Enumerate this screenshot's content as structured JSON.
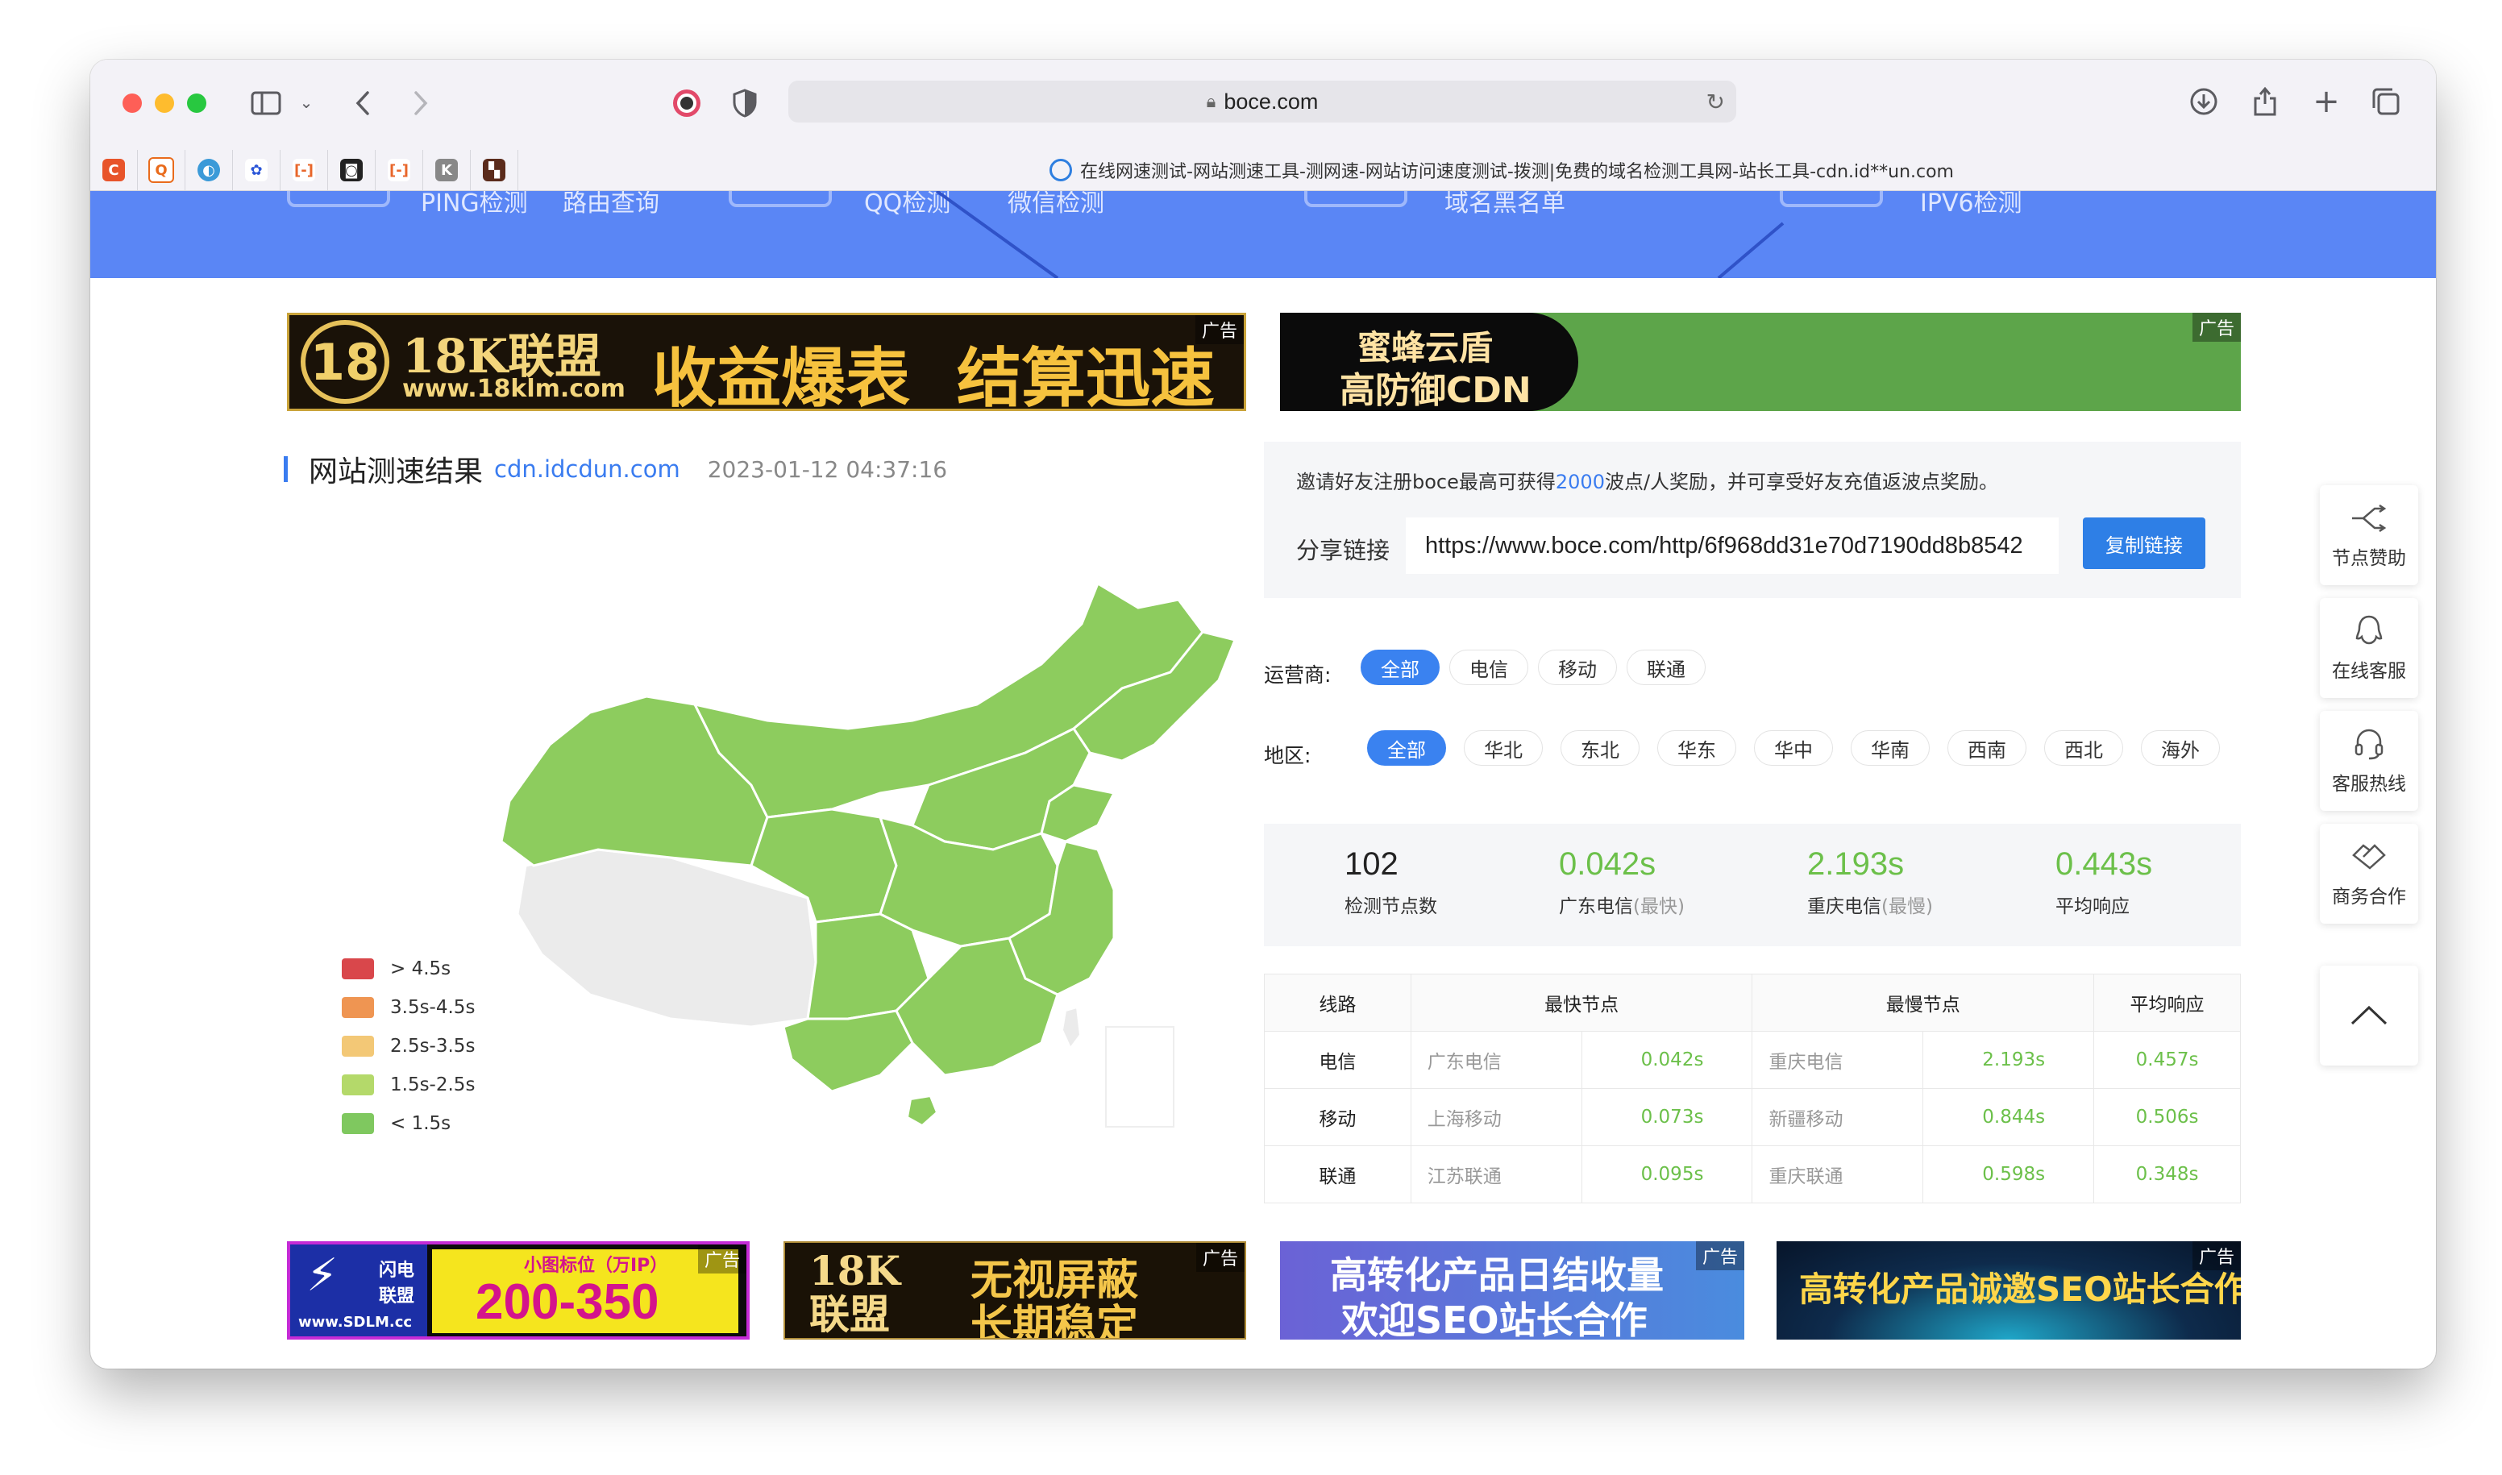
{
  "browser": {
    "url": "boce.com",
    "tab_title": "在线网速测试-网站测速工具-测网速-网站访问速度测试-拨测|免费的域名检测工具网-站长工具-cdn.id**un.com"
  },
  "nav_banner": {
    "items": [
      "PING检测",
      "路由查询",
      "QQ检测",
      "微信检测",
      "域名黑名单",
      "IPV6检测"
    ]
  },
  "ads_top": [
    {
      "lines": [
        "18K联盟",
        "www.18klm.com",
        "收益爆表",
        "结算迅速"
      ],
      "tag": "广告"
    },
    {
      "lines": [
        "蜜蜂云盾",
        "高防御CDN"
      ],
      "tag": "广告"
    }
  ],
  "result": {
    "title": "网站测速结果",
    "domain": "cdn.idcdun.com",
    "datetime": "2023-01-12 04:37:16"
  },
  "legend": [
    {
      "label": "> 4.5s",
      "color": "#d9474b"
    },
    {
      "label": "3.5s-4.5s",
      "color": "#ef9552"
    },
    {
      "label": "2.5s-3.5s",
      "color": "#f3c876"
    },
    {
      "label": "1.5s-2.5s",
      "color": "#b4d96a"
    },
    {
      "label": "< 1.5s",
      "color": "#7fc85f"
    }
  ],
  "map": {
    "region_fill": "#8dcc5e",
    "border": "#ffffff",
    "missing_fill": "#ebebeb"
  },
  "share": {
    "invite_pre": "邀请好友注册boce最高可获得",
    "invite_num": "2000",
    "invite_post": "波点/人奖励，并可享受好友充值返波点奖励。",
    "label": "分享链接",
    "link": "https://www.boce.com/http/6f968dd31e70d7190dd8b8542",
    "copy_button": "复制链接"
  },
  "filters": {
    "carrier_label": "运营商:",
    "carriers": [
      "全部",
      "电信",
      "移动",
      "联通"
    ],
    "region_label": "地区:",
    "regions": [
      "全部",
      "华北",
      "东北",
      "华东",
      "华中",
      "华南",
      "西南",
      "西北",
      "海外"
    ]
  },
  "stats": [
    {
      "value": "102",
      "label": "检测节点数",
      "note": "",
      "color": "#222222"
    },
    {
      "value": "0.042s",
      "label": "广东电信",
      "note": "(最快)",
      "color": "#6cc04a"
    },
    {
      "value": "2.193s",
      "label": "重庆电信",
      "note": "(最慢)",
      "color": "#6cc04a"
    },
    {
      "value": "0.443s",
      "label": "平均响应",
      "note": "",
      "color": "#6cc04a"
    }
  ],
  "table": {
    "headers": [
      "线路",
      "最快节点",
      "最慢节点",
      "平均响应"
    ],
    "rows": [
      {
        "line": "电信",
        "fast_node": "广东电信",
        "fast_val": "0.042s",
        "slow_node": "重庆电信",
        "slow_val": "2.193s",
        "avg": "0.457s"
      },
      {
        "line": "移动",
        "fast_node": "上海移动",
        "fast_val": "0.073s",
        "slow_node": "新疆移动",
        "slow_val": "0.844s",
        "avg": "0.506s"
      },
      {
        "line": "联通",
        "fast_node": "江苏联通",
        "fast_val": "0.095s",
        "slow_node": "重庆联通",
        "slow_val": "0.598s",
        "avg": "0.348s"
      }
    ]
  },
  "sidebar": [
    {
      "label": "节点赞助",
      "icon": "share-icon"
    },
    {
      "label": "在线客服",
      "icon": "qq-icon"
    },
    {
      "label": "客服热线",
      "icon": "headset-icon"
    },
    {
      "label": "商务合作",
      "icon": "handshake-icon"
    }
  ],
  "ads_bottom": [
    {
      "lines": [
        "闪电联盟",
        "www.SDLM.cc",
        "小图标位（万IP）",
        "200-350"
      ],
      "tag": "广告"
    },
    {
      "lines": [
        "18K联盟",
        "无视屏蔽",
        "长期稳定"
      ],
      "tag": "广告"
    },
    {
      "lines": [
        "高转化产品日结收量",
        "欢迎SEO站长合作"
      ],
      "tag": "广告"
    },
    {
      "lines": [
        "高转化产品诚邀SEO站长合作"
      ],
      "tag": "广告"
    }
  ]
}
